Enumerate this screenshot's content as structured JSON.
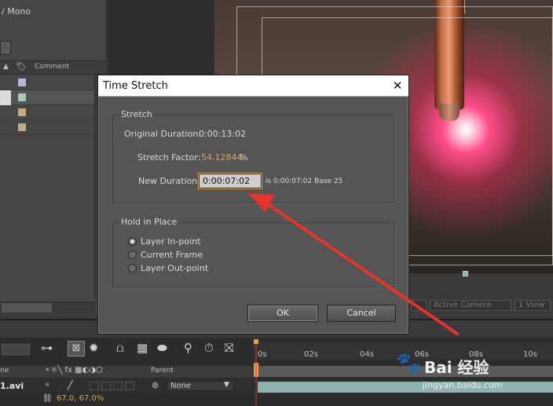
{
  "left_panel": {
    "top_text": "/ Mono",
    "comment_header": "Comment",
    "swatch_colors": [
      "#b9b3d6",
      "#a9c8c4",
      "#c8aa80",
      "#c0a88a"
    ]
  },
  "viewer_toolbar": {
    "camera": "Active Camera",
    "view": "1 View"
  },
  "dialog": {
    "title": "Time Stretch",
    "close_glyph": "✕",
    "stretch_group": "Stretch",
    "original_duration_label": "Original Duration:",
    "original_duration_value": "0:00:13:02",
    "stretch_factor_label": "Stretch Factor:",
    "stretch_factor_value": "54.12844",
    "stretch_factor_unit": "%",
    "new_duration_label": "New Duration:",
    "new_duration_value": "0:00:07:02",
    "new_duration_info": "is 0:00:07:02  Base 25",
    "hold_group": "Hold in Place",
    "hold_options": [
      {
        "label": "Layer In-point",
        "selected": true
      },
      {
        "label": "Current Frame",
        "selected": false
      },
      {
        "label": "Layer Out-point",
        "selected": false
      }
    ],
    "ok_label": "OK",
    "cancel_label": "Cancel"
  },
  "timeline": {
    "ruler_ticks": [
      "0s",
      "02s",
      "04s",
      "06s",
      "08s",
      "10s"
    ],
    "column_name": "ne",
    "column_parent": "Parent",
    "layer_name": "1.avi",
    "parent_value": "None",
    "scale_value": "67.0, 67.0%",
    "accent_color": "#e0a14a"
  },
  "watermark": {
    "brand": "Bai 经验",
    "site": "jingyan.baidu.com"
  },
  "annotation": {
    "arrow_color": "#e8322c"
  }
}
